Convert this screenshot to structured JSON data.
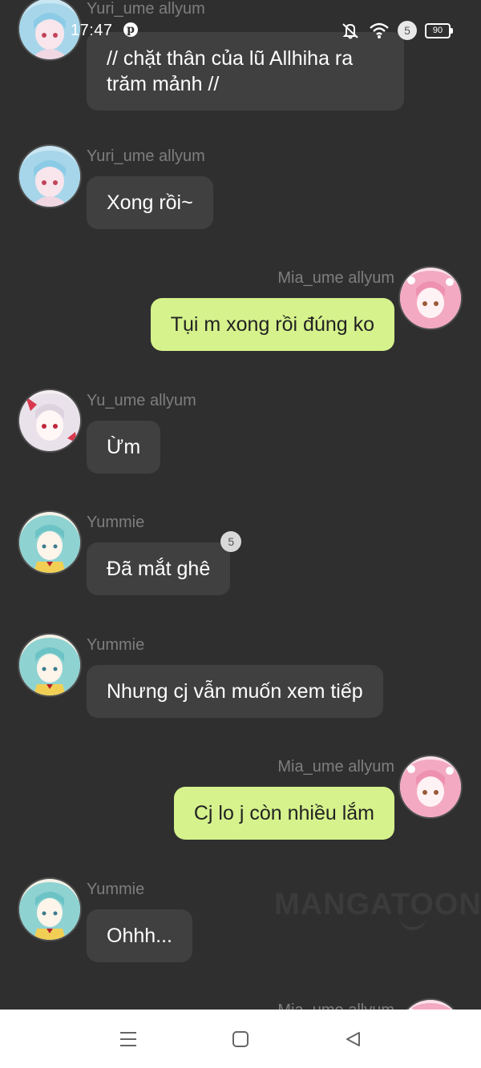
{
  "status_bar": {
    "time": "17:47",
    "notification_count": "5",
    "battery": "90",
    "icons": [
      "pinterest-icon",
      "mute-icon",
      "wifi-icon",
      "battery-icon"
    ]
  },
  "messages": [
    {
      "side": "left",
      "sender": "Yuri_ume allyum",
      "text": "// chặt thân của lũ Allhiha ra trăm mảnh //",
      "avatar": "blue-hair-avatar"
    },
    {
      "side": "left",
      "sender": "Yuri_ume allyum",
      "text": "Xong rồi~",
      "avatar": "blue-hair-avatar"
    },
    {
      "side": "right",
      "sender": "Mia_ume allyum",
      "text": "Tụi m xong rồi đúng ko",
      "avatar": "pink-hair-avatar"
    },
    {
      "side": "left",
      "sender": "Yu_ume allyum",
      "text": "Ừm",
      "avatar": "white-hair-avatar"
    },
    {
      "side": "left",
      "sender": "Yummie",
      "text": "Đã mắt ghê",
      "badge": "5",
      "avatar": "teal-hair-avatar"
    },
    {
      "side": "left",
      "sender": "Yummie",
      "text": "Nhưng cj vẫn muốn xem tiếp",
      "avatar": "teal-hair-avatar"
    },
    {
      "side": "right",
      "sender": "Mia_ume allyum",
      "text": "Cj lo j còn nhiều lắm",
      "avatar": "pink-hair-avatar"
    },
    {
      "side": "left",
      "sender": "Yummie",
      "text": "Ohhh...",
      "avatar": "teal-hair-avatar"
    },
    {
      "side": "right",
      "sender": "Mia_ume allyum",
      "text": "",
      "avatar": "pink-hair-avatar"
    }
  ],
  "watermark": "MANGATOON",
  "colors": {
    "background": "#2f2f2f",
    "left_bubble": "#404040",
    "right_bubble": "#d5f28c",
    "sender_name": "#7e7e7e"
  },
  "nav_bar": {
    "icons": [
      "menu-icon",
      "home-icon",
      "back-icon"
    ]
  }
}
